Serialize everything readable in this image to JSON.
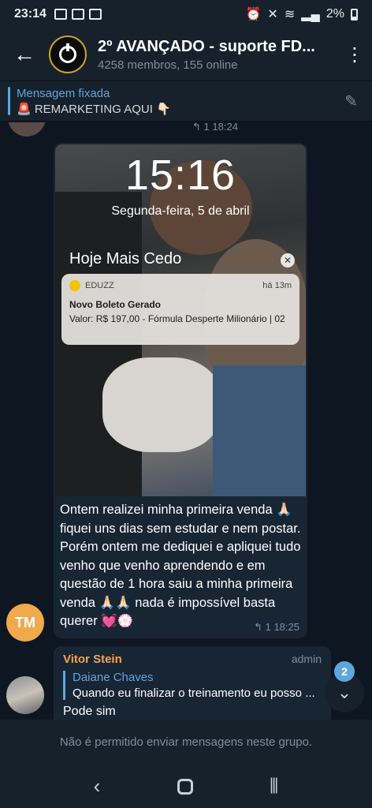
{
  "status_bar": {
    "time": "23:14",
    "battery": "2%"
  },
  "header": {
    "back_icon": "back-arrow-icon",
    "title": "2º AVANÇADO - suporte FD...",
    "subtitle": "4258 membros, 155 online"
  },
  "pinned": {
    "title": "Mensagem fixada",
    "text": "🚨 REMARKETING AQUI 👇🏻"
  },
  "prev_message": {
    "replies": "1",
    "time": "18:24"
  },
  "message": {
    "lockscreen": {
      "clock": "15:16",
      "date": "Segunda-feira, 5 de abril",
      "section": "Hoje Mais Cedo",
      "notification": {
        "app": "EDUZZ",
        "time": "há 13m",
        "title": "Novo Boleto Gerado",
        "body": "Valor: R$ 197,00 - Fórmula Desperte Milionário | 02"
      }
    },
    "text": "Ontem realizei minha primeira venda 🙏🏻 fiquei uns dias sem estudar e nem postar. Porém ontem me dediquei e apliquei tudo venho que venho aprendendo e em questão de 1 hora saiu a minha primeira venda 🙏🏻🙏🏻 nada é impossível basta querer 💓💮",
    "replies": "1",
    "time": "18:25",
    "sender_initials": "TM"
  },
  "message2": {
    "sender": "Vitor Stein",
    "role": "admin",
    "reply_to_name": "Daiane Chaves",
    "reply_to_text": "Quando eu finalizar o treinamento eu posso ...",
    "text": "Pode sim"
  },
  "unread_badge": "2",
  "footer": {
    "notice": "Não é permitido enviar mensagens neste grupo."
  },
  "colors": {
    "background": "#0e1621",
    "bar": "#17212b",
    "bubble": "#182533",
    "accent": "#5ea6e0",
    "sender_name": "#f5a35a"
  }
}
